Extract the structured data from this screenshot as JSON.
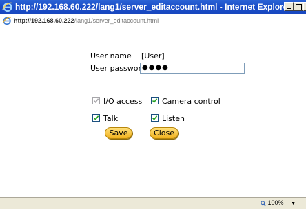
{
  "window": {
    "title": "http://192.168.60.222/lang1/server_editaccount.html - Internet Explorer"
  },
  "address": {
    "host": "http://192.168.60.222",
    "path": "/lang1/server_editaccount.html"
  },
  "form": {
    "user_name_label": "User name",
    "user_name_value": "[User]",
    "password_label": "User password",
    "password_value": "●●●●",
    "io_access_label": "I/O access",
    "camera_control_label": "Camera control",
    "talk_label": "Talk",
    "listen_label": "Listen",
    "io_access_checked": true,
    "camera_control_checked": true,
    "talk_checked": true,
    "listen_checked": true,
    "io_access_disabled": true
  },
  "buttons": {
    "save_label": "Save",
    "close_label": "Close"
  },
  "status": {
    "zoom": "100%"
  },
  "colors": {
    "titlebar": "#1b4fc9",
    "button_fill": "#f2b21f",
    "checkbox_border": "#1c5180"
  }
}
